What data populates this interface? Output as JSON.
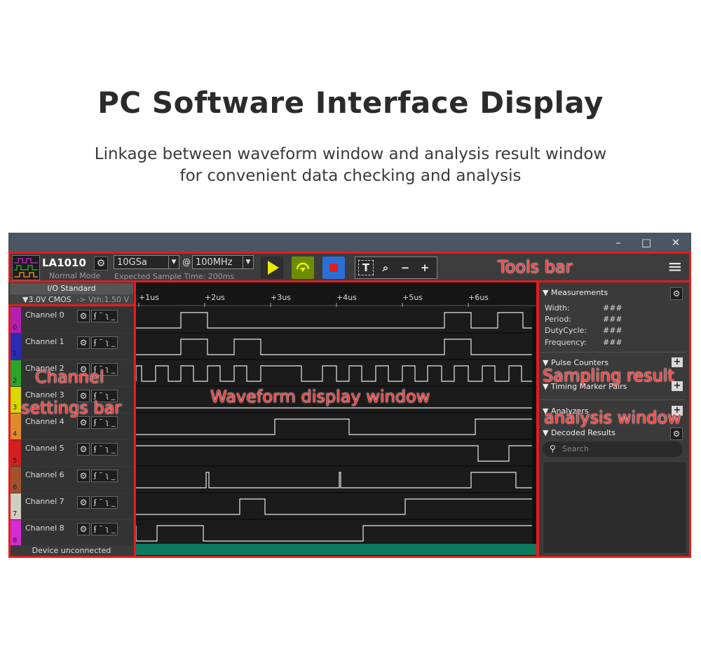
{
  "heading": {
    "title": "PC Software Interface Display",
    "subtitle_line1": "Linkage between waveform window and analysis result window",
    "subtitle_line2": "for convenient data checking and analysis"
  },
  "window": {
    "controls": [
      "–",
      "□",
      "✕"
    ]
  },
  "toolbar": {
    "device": "LA1010",
    "mode": "Normal Mode",
    "sample_depth": "10GSa",
    "at_symbol": "@",
    "sample_rate": "100MHz",
    "expected_time": "Expected Sample Time: 200ms",
    "tool_icons": [
      "T",
      "⌕",
      "−",
      "+"
    ],
    "menu_icon": "≡"
  },
  "io": {
    "header": "I/O Standard",
    "standard": "▼3.0V CMOS",
    "vth": "-> Vth:1.50 V"
  },
  "channels": [
    {
      "name": "Channel 0",
      "num": "0",
      "color": "#b31eb3"
    },
    {
      "name": "Channel 1",
      "num": "1",
      "color": "#2b2bb8"
    },
    {
      "name": "Channel 2",
      "num": "2",
      "color": "#2aa52a"
    },
    {
      "name": "Channel 3",
      "num": "3",
      "color": "#d9d900"
    },
    {
      "name": "Channel 4",
      "num": "4",
      "color": "#e08a2c"
    },
    {
      "name": "Channel 5",
      "num": "5",
      "color": "#d21f1f"
    },
    {
      "name": "Channel 6",
      "num": "6",
      "color": "#a0522d"
    },
    {
      "name": "Channel 7",
      "num": "7",
      "color": "#cfcfc0"
    },
    {
      "name": "Channel 8",
      "num": "8",
      "color": "#d42bd4"
    }
  ],
  "channel_controls": {
    "gear": "⚙",
    "edges": "ʄ ¯ ʅ _"
  },
  "device_status": "Device unconnected",
  "ruler_ticks": [
    "+1us",
    "+2us",
    "+3us",
    "+4us",
    "+5us",
    "+6us"
  ],
  "analysis": {
    "measurements_title": "▼ Measurements",
    "measurements": [
      {
        "key": "Width:",
        "value": "###"
      },
      {
        "key": "Period:",
        "value": "###"
      },
      {
        "key": "DutyCycle:",
        "value": "###"
      },
      {
        "key": "Frequency:",
        "value": "###"
      }
    ],
    "pulse_counters": "▼ Pulse Counters",
    "timing_markers": "▼ Timing Marker Pairs",
    "analyzers": "▼ Analyzers",
    "decoded_results": "▼ Decoded Results",
    "search_placeholder": "Search"
  },
  "annotations": {
    "tools_bar": "Tools bar",
    "channel_line1": "Channel",
    "channel_line2": "settings bar",
    "waveform": "Waveform display window",
    "sampling_line1": "Sampling result",
    "sampling_line2": "analysis window"
  },
  "colors": {
    "annotation_red": "#e21c1c",
    "play_green": "#1f9d1f",
    "loop_green": "#6b8e00",
    "stop_blue": "#2a6fd6",
    "scroll_teal": "#0c7a5f"
  }
}
